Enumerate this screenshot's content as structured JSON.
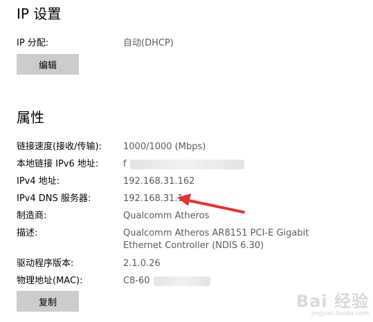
{
  "ip_settings": {
    "title": "IP 设置",
    "assignment_label": "IP 分配:",
    "assignment_value": "自动(DHCP)",
    "edit_button": "编辑"
  },
  "properties": {
    "title": "属性",
    "rows": [
      {
        "label": "链接速度(接收/传输):",
        "value": "1000/1000 (Mbps)"
      },
      {
        "label": "本地链接 IPv6 地址:",
        "value": "f"
      },
      {
        "label": "IPv4 地址:",
        "value": "192.168.31.162"
      },
      {
        "label": "IPv4 DNS 服务器:",
        "value": "192.168.31.1"
      },
      {
        "label": "制造商:",
        "value": "Qualcomm Atheros"
      },
      {
        "label": "描述:",
        "value": "Qualcomm Atheros AR8151 PCI-E Gigabit",
        "value2": "Ethernet Controller (NDIS 6.30)"
      },
      {
        "label": "驱动程序版本:",
        "value": "2.1.0.26"
      },
      {
        "label": "物理地址(MAC):",
        "value": "C8-60"
      }
    ],
    "copy_button": "复制"
  },
  "annotation": {
    "arrow_color": "#e8322d"
  },
  "watermark": {
    "main": "Bai 经验",
    "sub": "jingyan.baidu.com"
  }
}
